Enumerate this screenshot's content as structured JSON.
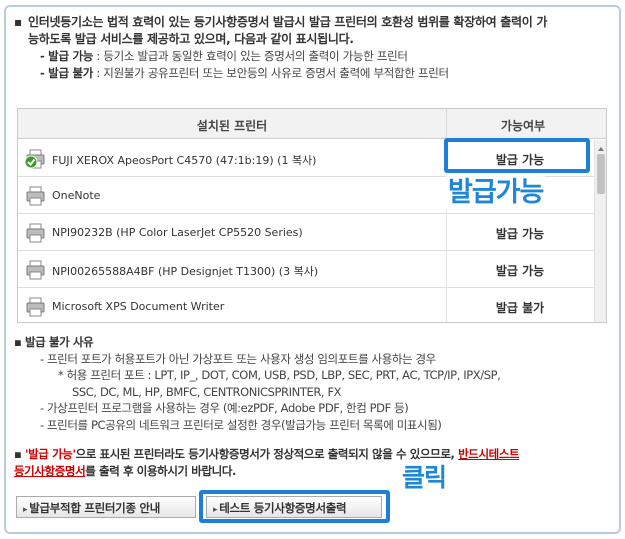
{
  "intro": {
    "bullet": "▪",
    "line1": "인터넷등기소는 법적 효력이 있는 등기사항증명서 발급시 발급 프린터의 호환성 범위를 확장하여 출력이 가",
    "line2": "능하도록 발급 서비스를 제공하고 있으며, 다음과 같이 표시됩니다.",
    "sub1_label": "- 발급 가능",
    "sub1_text": " : 등기소 발급과 동일한 효력이 있는 증명서의 출력이 가능한 프린터",
    "sub2_label": "- 발급 불가",
    "sub2_text": " : 지원불가 공유프린터 또는 보안등의 사유로 증명서 출력에 부적합한 프린터"
  },
  "table": {
    "col_printer": "설치된 프린터",
    "col_status": "가능여부",
    "rows": [
      {
        "name": "FUJI XEROX ApeosPort C4570 (47:1b:19) (1 복사)",
        "status": "발급 가능"
      },
      {
        "name": "OneNote",
        "status": ""
      },
      {
        "name": "NPI90232B (HP Color LaserJet CP5520 Series)",
        "status": "발급 가능"
      },
      {
        "name": "NPI00265588A4BF (HP Designjet T1300) (3 복사)",
        "status": "발급 가능"
      },
      {
        "name": "Microsoft XPS Document Writer",
        "status": "발급 불가"
      }
    ]
  },
  "callouts": {
    "available": "발급가능",
    "click": "클릭"
  },
  "reasons": {
    "heading": "▪ 발급 불가 사유",
    "line1": "- 프린터 포트가 허용포트가 아닌 가상포트 또는 사용자 생성 임의포트를 사용하는 경우",
    "line2": "* 허용 프린터 포트 : LPT, IP_, DOT, COM, USB, PSD, LBP, SEC, PRT, AC, TCP/IP, IPX/SP,",
    "line3": "SSC, DC, ML, HP, BMFC, CENTRONICSPRINTER, FX",
    "line4": "- 가상프린터 프로그램을 사용하는 경우 (예:ezPDF, Adobe PDF, 한컴 PDF 등)",
    "line5": "- 프린터를 PC공유의 네트워크 프린터로 설정한 경우(발급가능 프린터 목록에 미표시됨)"
  },
  "warning": {
    "bullet": "▪ ",
    "red1": "'발급 가능'",
    "text1": "으로 표시된 프린터라도 등기사항증명서가 정상적으로 출력되지 않을 수 있으므로, ",
    "red2": "반드시테스트",
    "red3": "등기사항증명서",
    "text2": "를 출력 후 이용하시기 바랍니다."
  },
  "buttons": {
    "guide": "발급부적합 프린터기종 안내",
    "test": "테스트 등기사항증명서출력"
  },
  "colors": {
    "highlight": "#1e7fd8",
    "warning_red": "#cc0000",
    "check_green": "#3a9a2a"
  }
}
